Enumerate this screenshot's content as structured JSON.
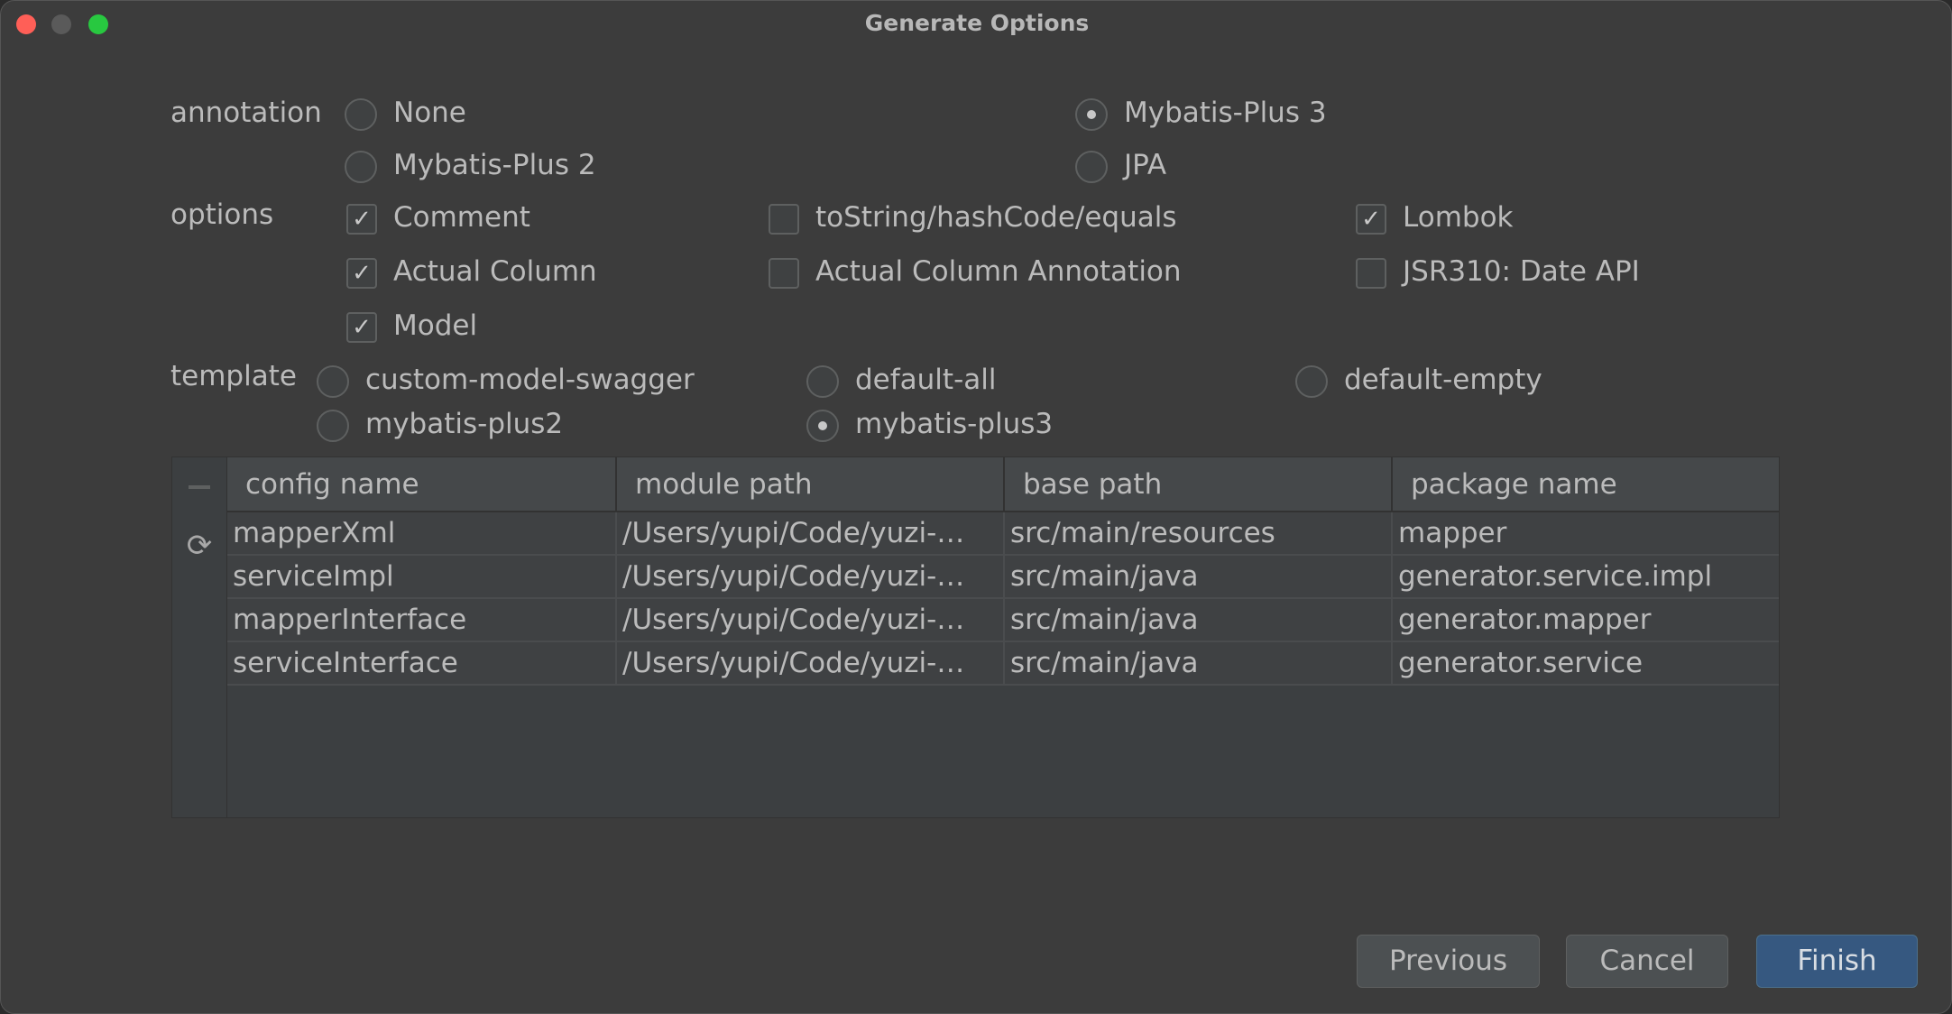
{
  "window": {
    "title": "Generate Options"
  },
  "annotation": {
    "label": "annotation",
    "options": [
      {
        "label": "None",
        "selected": false
      },
      {
        "label": "Mybatis-Plus 3",
        "selected": true
      },
      {
        "label": "Mybatis-Plus 2",
        "selected": false
      },
      {
        "label": "JPA",
        "selected": false
      }
    ]
  },
  "options": {
    "label": "options",
    "items": [
      {
        "label": "Comment",
        "checked": true
      },
      {
        "label": "toString/hashCode/equals",
        "checked": false
      },
      {
        "label": "Lombok",
        "checked": true
      },
      {
        "label": "Actual Column",
        "checked": true
      },
      {
        "label": "Actual Column Annotation",
        "checked": false
      },
      {
        "label": "JSR310: Date API",
        "checked": false
      },
      {
        "label": "Model",
        "checked": true
      }
    ]
  },
  "template": {
    "label": "template",
    "options": [
      {
        "label": "custom-model-swagger",
        "selected": false
      },
      {
        "label": "default-all",
        "selected": false
      },
      {
        "label": "default-empty",
        "selected": false
      },
      {
        "label": "mybatis-plus2",
        "selected": false
      },
      {
        "label": "mybatis-plus3",
        "selected": true
      }
    ]
  },
  "table": {
    "toolbar": {
      "remove_icon": "minus-icon",
      "refresh_icon": "refresh-icon"
    },
    "columns": [
      "config name",
      "module path",
      "base path",
      "package name"
    ],
    "rows": [
      [
        "mapperXml",
        "/Users/yupi/Code/yuzi-…",
        "src/main/resources",
        "mapper"
      ],
      [
        "serviceImpl",
        "/Users/yupi/Code/yuzi-…",
        "src/main/java",
        "generator.service.impl"
      ],
      [
        "mapperInterface",
        "/Users/yupi/Code/yuzi-…",
        "src/main/java",
        "generator.mapper"
      ],
      [
        "serviceInterface",
        "/Users/yupi/Code/yuzi-…",
        "src/main/java",
        "generator.service"
      ]
    ]
  },
  "buttons": {
    "previous": "Previous",
    "cancel": "Cancel",
    "finish": "Finish"
  },
  "colors": {
    "primary": "#365880",
    "close": "#ff5f57",
    "zoom": "#28c840"
  }
}
